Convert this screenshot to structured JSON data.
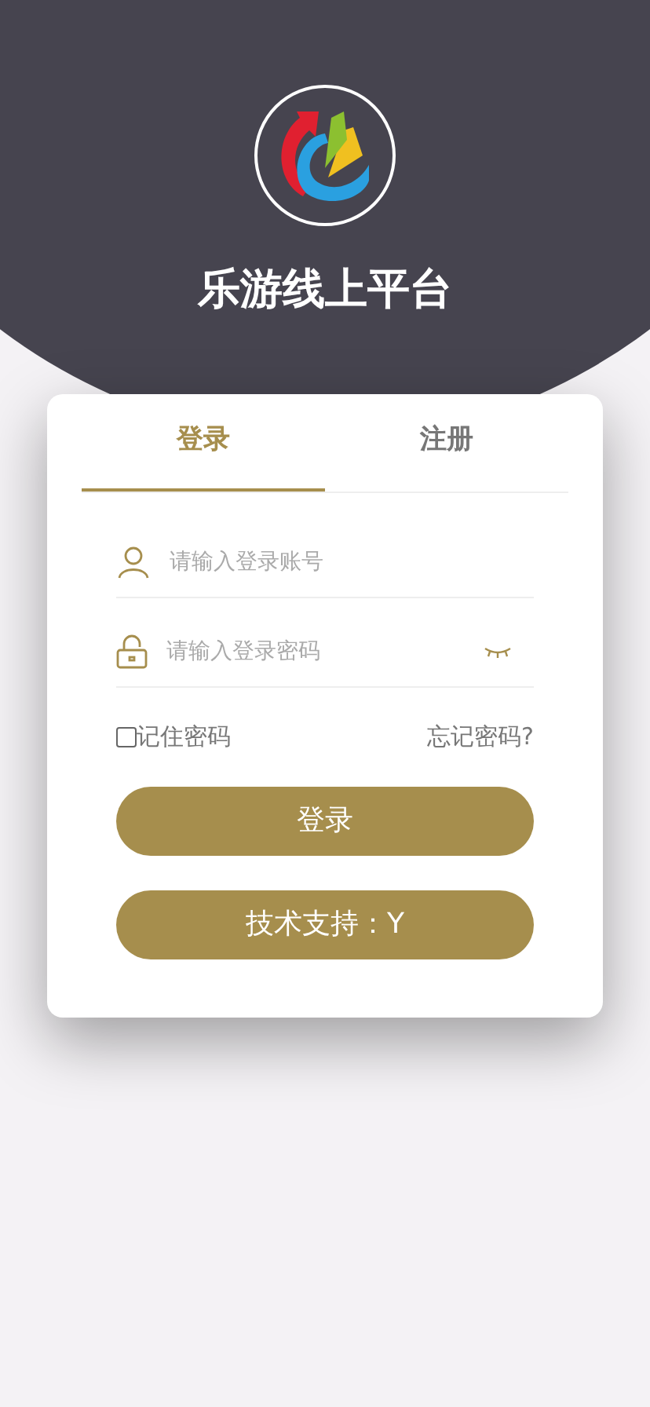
{
  "header": {
    "title": "乐游线上平台"
  },
  "tabs": [
    {
      "label": "登录",
      "selected": true
    },
    {
      "label": "注册",
      "selected": false
    }
  ],
  "fields": [
    {
      "kind": "account",
      "placeholder": "请输入登录账号"
    },
    {
      "kind": "password",
      "placeholder": "请输入登录密码"
    }
  ],
  "remember": {
    "label": "记住密码",
    "checked": false
  },
  "forgot_link": "忘记密码?",
  "buttons": [
    "登录",
    "技术支持：Y"
  ]
}
